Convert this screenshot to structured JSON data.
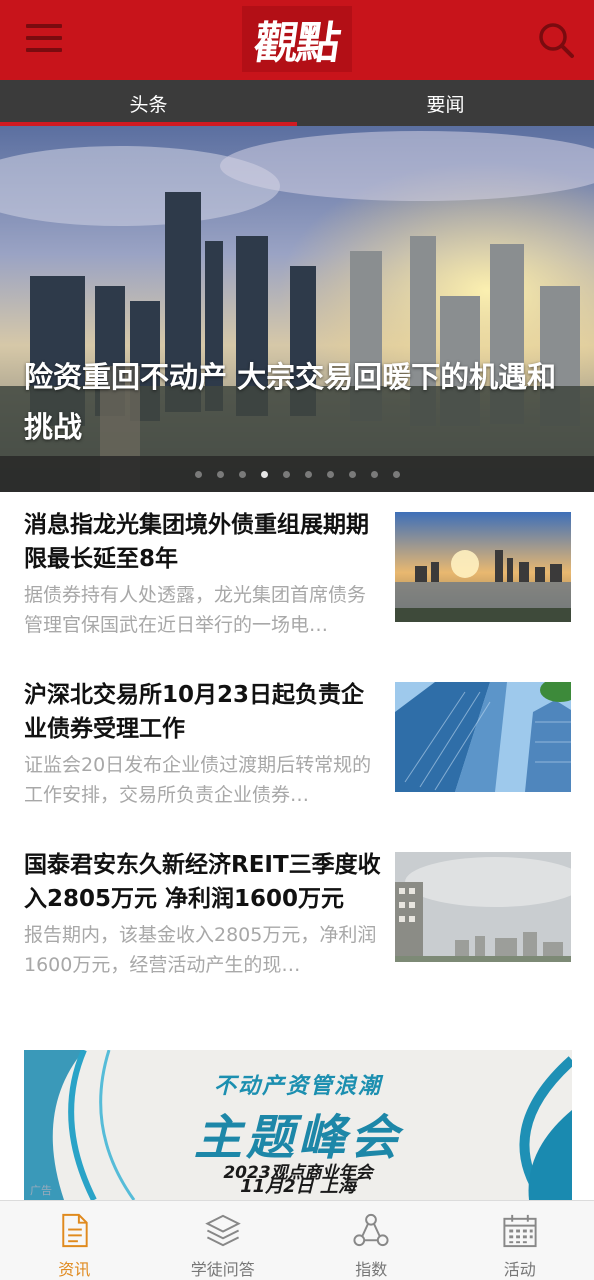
{
  "header": {
    "logo_text": "觀點",
    "menu_icon": "hamburger-menu-icon",
    "search_icon": "search-icon",
    "brand_color": "#c8141b"
  },
  "tabs": [
    {
      "label": "头条",
      "active": true
    },
    {
      "label": "要闻",
      "active": false
    }
  ],
  "hero": {
    "title": "险资重回不动产 大宗交易回暖下的机遇和挑战",
    "slide_count": 10,
    "active_slide": 4
  },
  "news": [
    {
      "title": "消息指龙光集团境外债重组展期期限最长延至8年",
      "summary": "据债券持有人处透露，龙光集团首席债务管理官保国武在近日举行的一场电…",
      "thumb": "city-skyline-sunset"
    },
    {
      "title": "沪深北交易所10月23日起负责企业债券受理工作",
      "summary": "证监会20日发布企业债过渡期后转常规的工作安排，交易所负责企业债券…",
      "thumb": "glass-skyscrapers"
    },
    {
      "title": "国泰君安东久新经济REIT三季度收入2805万元 净利润1600万元",
      "summary": "报告期内，该基金收入2805万元，净利润1600万元，经营活动产生的现…",
      "thumb": "cloudy-city-view"
    }
  ],
  "ad": {
    "top_line": "不动产资管浪潮",
    "main_line": "主题峰会",
    "sub_line": "2023观点商业年会",
    "date_line": "11月2日  上海",
    "tag": "广告"
  },
  "bottom_nav": [
    {
      "label": "资讯",
      "icon": "document-icon",
      "active": true
    },
    {
      "label": "学徒问答",
      "icon": "layers-icon",
      "active": false
    },
    {
      "label": "指数",
      "icon": "network-icon",
      "active": false
    },
    {
      "label": "活动",
      "icon": "calendar-icon",
      "active": false
    }
  ]
}
